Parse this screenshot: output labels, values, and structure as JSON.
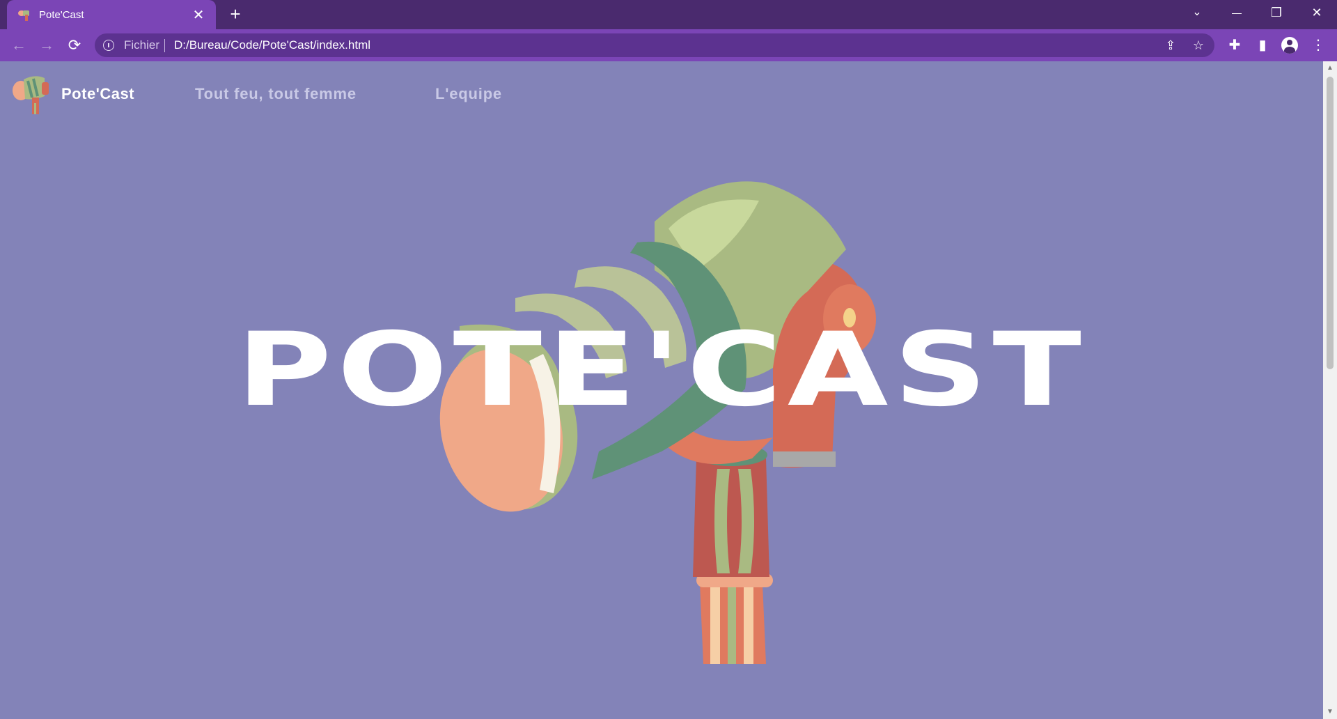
{
  "browser": {
    "tab": {
      "title": "Pote'Cast",
      "close_glyph": "✕"
    },
    "new_tab_glyph": "+",
    "window_controls": {
      "list_tabs_glyph": "⌄",
      "minimize_glyph": "—",
      "restore_glyph": "❐",
      "close_glyph": "✕"
    },
    "nav": {
      "back_glyph": "←",
      "forward_glyph": "→",
      "reload_glyph": "⟳"
    },
    "omnibox": {
      "scheme_label": "Fichier",
      "url": "D:/Bureau/Code/Pote'Cast/index.html",
      "share_glyph": "⇪",
      "bookmark_glyph": "☆"
    },
    "toolbar_icons": {
      "extensions_glyph": "✚",
      "side_panel_glyph": "▮",
      "menu_glyph": "⋮"
    },
    "colors": {
      "tabbar": "#4a2a6e",
      "active_tab": "#7b45b6",
      "omnibox": "#5c3290"
    }
  },
  "site": {
    "brand": "Pote'Cast",
    "nav_links": [
      "Tout feu, tout femme",
      "L'equipe"
    ],
    "hero_title": "POTE'CAST",
    "background_color": "#8383b8",
    "hero_image": "microphone-illustration"
  }
}
